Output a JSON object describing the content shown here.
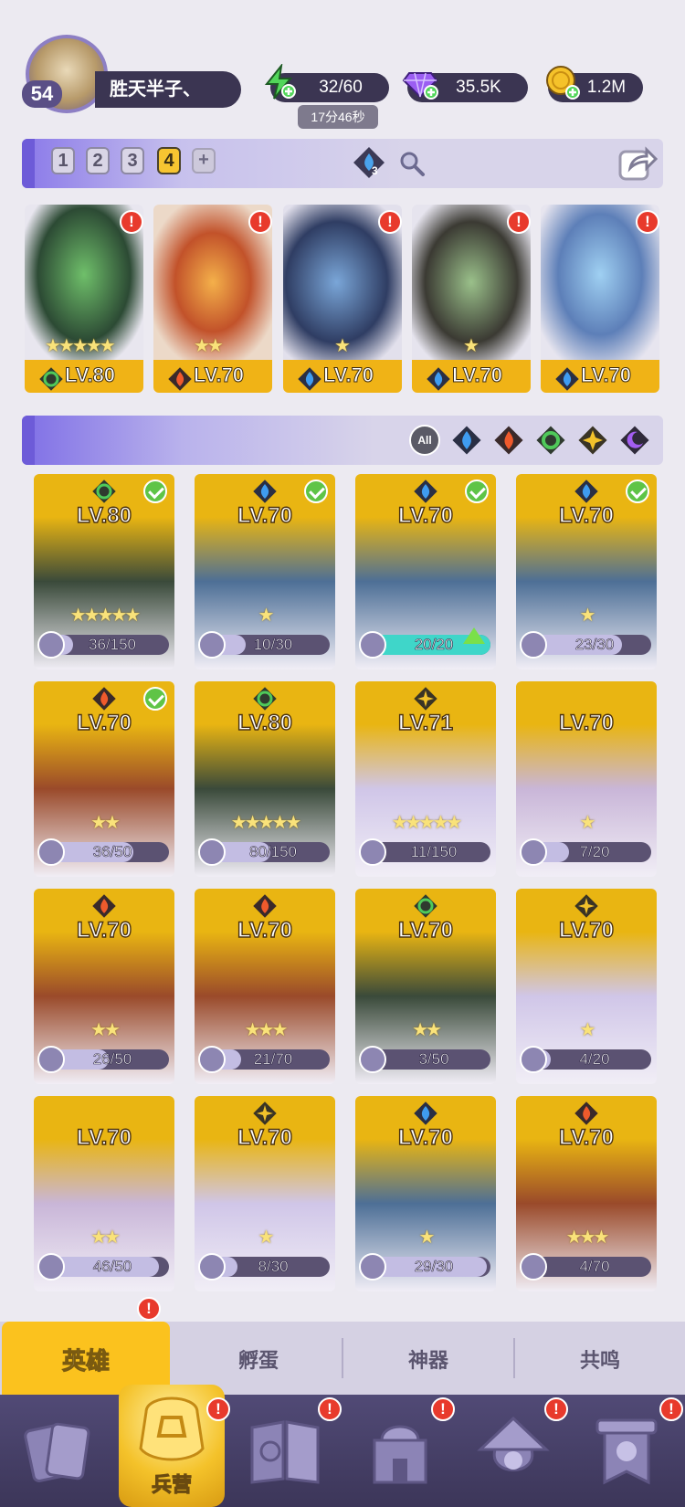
{
  "player": {
    "level": "54",
    "name": "胜天半子、"
  },
  "resources": {
    "energy": "32/60",
    "energy_timer": "17分46秒",
    "gems": "35.5K",
    "gold": "1.2M"
  },
  "team_tabs": [
    "1",
    "2",
    "3",
    "4"
  ],
  "team_tab_add": "+",
  "team_active_tab": 4,
  "team_element_count": "3",
  "team_slots": [
    {
      "level": "LV.80",
      "element": "nature",
      "stars": "★★★★★",
      "alert": "!"
    },
    {
      "level": "LV.70",
      "element": "fire",
      "stars": "★★",
      "alert": "!"
    },
    {
      "level": "LV.70",
      "element": "water",
      "stars": "★",
      "alert": "!"
    },
    {
      "level": "LV.70",
      "element": "water",
      "stars": "★",
      "alert": "!"
    },
    {
      "level": "LV.70",
      "element": "water",
      "stars": "",
      "alert": "!"
    }
  ],
  "filters": {
    "all_label": "All",
    "elements": [
      "water",
      "fire",
      "nature",
      "light",
      "dark"
    ]
  },
  "heroes": [
    {
      "level": "LV.80",
      "element": "nature",
      "shards": "36/150",
      "progress": 0.24,
      "check": true,
      "stars": "★★★★★"
    },
    {
      "level": "LV.70",
      "element": "water",
      "shards": "10/30",
      "progress": 0.33,
      "check": true,
      "stars": "★"
    },
    {
      "level": "LV.70",
      "element": "water",
      "shards": "20/20",
      "progress": 1.0,
      "check": true,
      "stars": "",
      "upgrade": true
    },
    {
      "level": "LV.70",
      "element": "water",
      "shards": "23/30",
      "progress": 0.77,
      "check": true,
      "stars": "★"
    },
    {
      "level": "LV.70",
      "element": "fire",
      "shards": "36/50",
      "progress": 0.72,
      "check": true,
      "stars": "★★"
    },
    {
      "level": "LV.80",
      "element": "nature",
      "shards": "80/150",
      "progress": 0.53,
      "check": false,
      "stars": "★★★★★"
    },
    {
      "level": "LV.71",
      "element": "light",
      "shards": "11/150",
      "progress": 0.07,
      "check": false,
      "stars": "★★★★★"
    },
    {
      "level": "LV.70",
      "element": "",
      "shards": "7/20",
      "progress": 0.35,
      "check": false,
      "stars": "★"
    },
    {
      "level": "LV.70",
      "element": "fire",
      "shards": "26/50",
      "progress": 0.52,
      "check": false,
      "stars": "★★"
    },
    {
      "level": "LV.70",
      "element": "fire",
      "shards": "21/70",
      "progress": 0.3,
      "check": false,
      "stars": "★★★"
    },
    {
      "level": "LV.70",
      "element": "nature",
      "shards": "3/50",
      "progress": 0.06,
      "check": false,
      "stars": "★★"
    },
    {
      "level": "LV.70",
      "element": "light",
      "shards": "4/20",
      "progress": 0.2,
      "check": false,
      "stars": "★"
    },
    {
      "level": "LV.70",
      "element": "",
      "shards": "46/50",
      "progress": 0.92,
      "check": false,
      "stars": "★★"
    },
    {
      "level": "LV.70",
      "element": "light",
      "shards": "8/30",
      "progress": 0.27,
      "check": false,
      "stars": "★"
    },
    {
      "level": "LV.70",
      "element": "water",
      "shards": "29/30",
      "progress": 0.97,
      "check": false,
      "stars": "★"
    },
    {
      "level": "LV.70",
      "element": "fire",
      "shards": "4/70",
      "progress": 0.06,
      "check": false,
      "stars": "★★★"
    }
  ],
  "sub_tabs": [
    {
      "label": "英雄",
      "active": true,
      "alert": "!"
    },
    {
      "label": "孵蛋",
      "active": false
    },
    {
      "label": "神器",
      "active": false
    },
    {
      "label": "共鸣",
      "active": false
    }
  ],
  "nav": [
    {
      "icon": "cards-icon",
      "label": "",
      "alert": ""
    },
    {
      "icon": "barracks-icon",
      "label": "兵营",
      "alert": "!",
      "active": true
    },
    {
      "icon": "map-book-icon",
      "label": "",
      "alert": "!"
    },
    {
      "icon": "castle-icon",
      "label": "",
      "alert": "!"
    },
    {
      "icon": "mushroom-house-icon",
      "label": "",
      "alert": "!"
    },
    {
      "icon": "guild-banner-icon",
      "label": "",
      "alert": "!"
    }
  ],
  "colors": {
    "water": "#3a8fe0",
    "fire": "#e04a2a",
    "nature": "#3aa84a",
    "light": "#e9b524",
    "dark": "#8a4ad6",
    "accent": "#f7c531",
    "panel": "#3b3552"
  }
}
